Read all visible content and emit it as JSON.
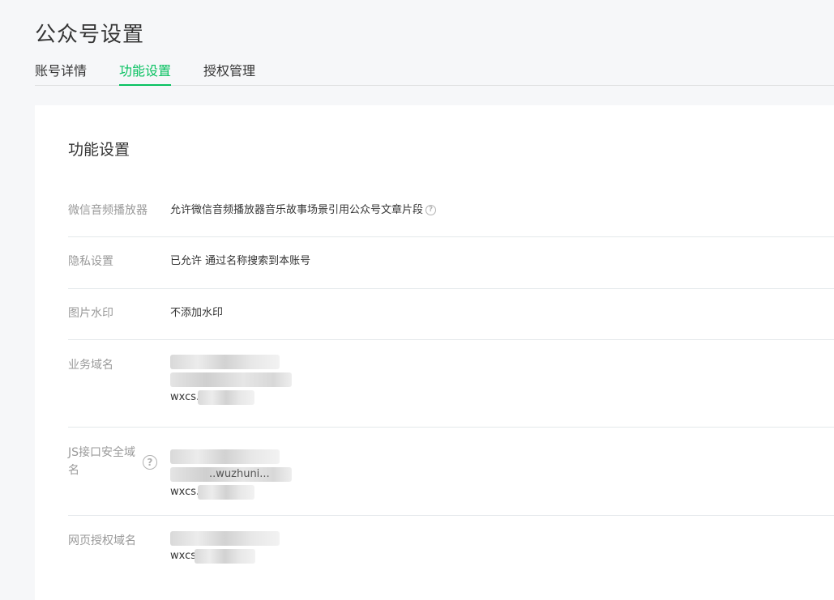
{
  "page": {
    "title": "公众号设置"
  },
  "tabs": [
    {
      "label": "账号详情"
    },
    {
      "label": "功能设置"
    },
    {
      "label": "授权管理"
    }
  ],
  "card": {
    "title": "功能设置"
  },
  "settings": {
    "audio_player": {
      "label": "微信音频播放器",
      "value": "允许微信音频播放器音乐故事场景引用公众号文章片段",
      "help_icon": "question-circle-icon"
    },
    "privacy": {
      "label": "隐私设置",
      "value": "已允许 通过名称搜索到本账号"
    },
    "watermark": {
      "label": "图片水印",
      "value": "不添加水印"
    },
    "business_domain": {
      "label": "业务域名",
      "prefix": "wxcs."
    },
    "js_domain": {
      "label": "JS接口安全域名",
      "fragment": "..wuzhuni...",
      "prefix": "wxcs.",
      "help_icon": "question-circle-icon"
    },
    "oauth_domain": {
      "label": "网页授权域名",
      "prefix": "wxcs"
    }
  }
}
